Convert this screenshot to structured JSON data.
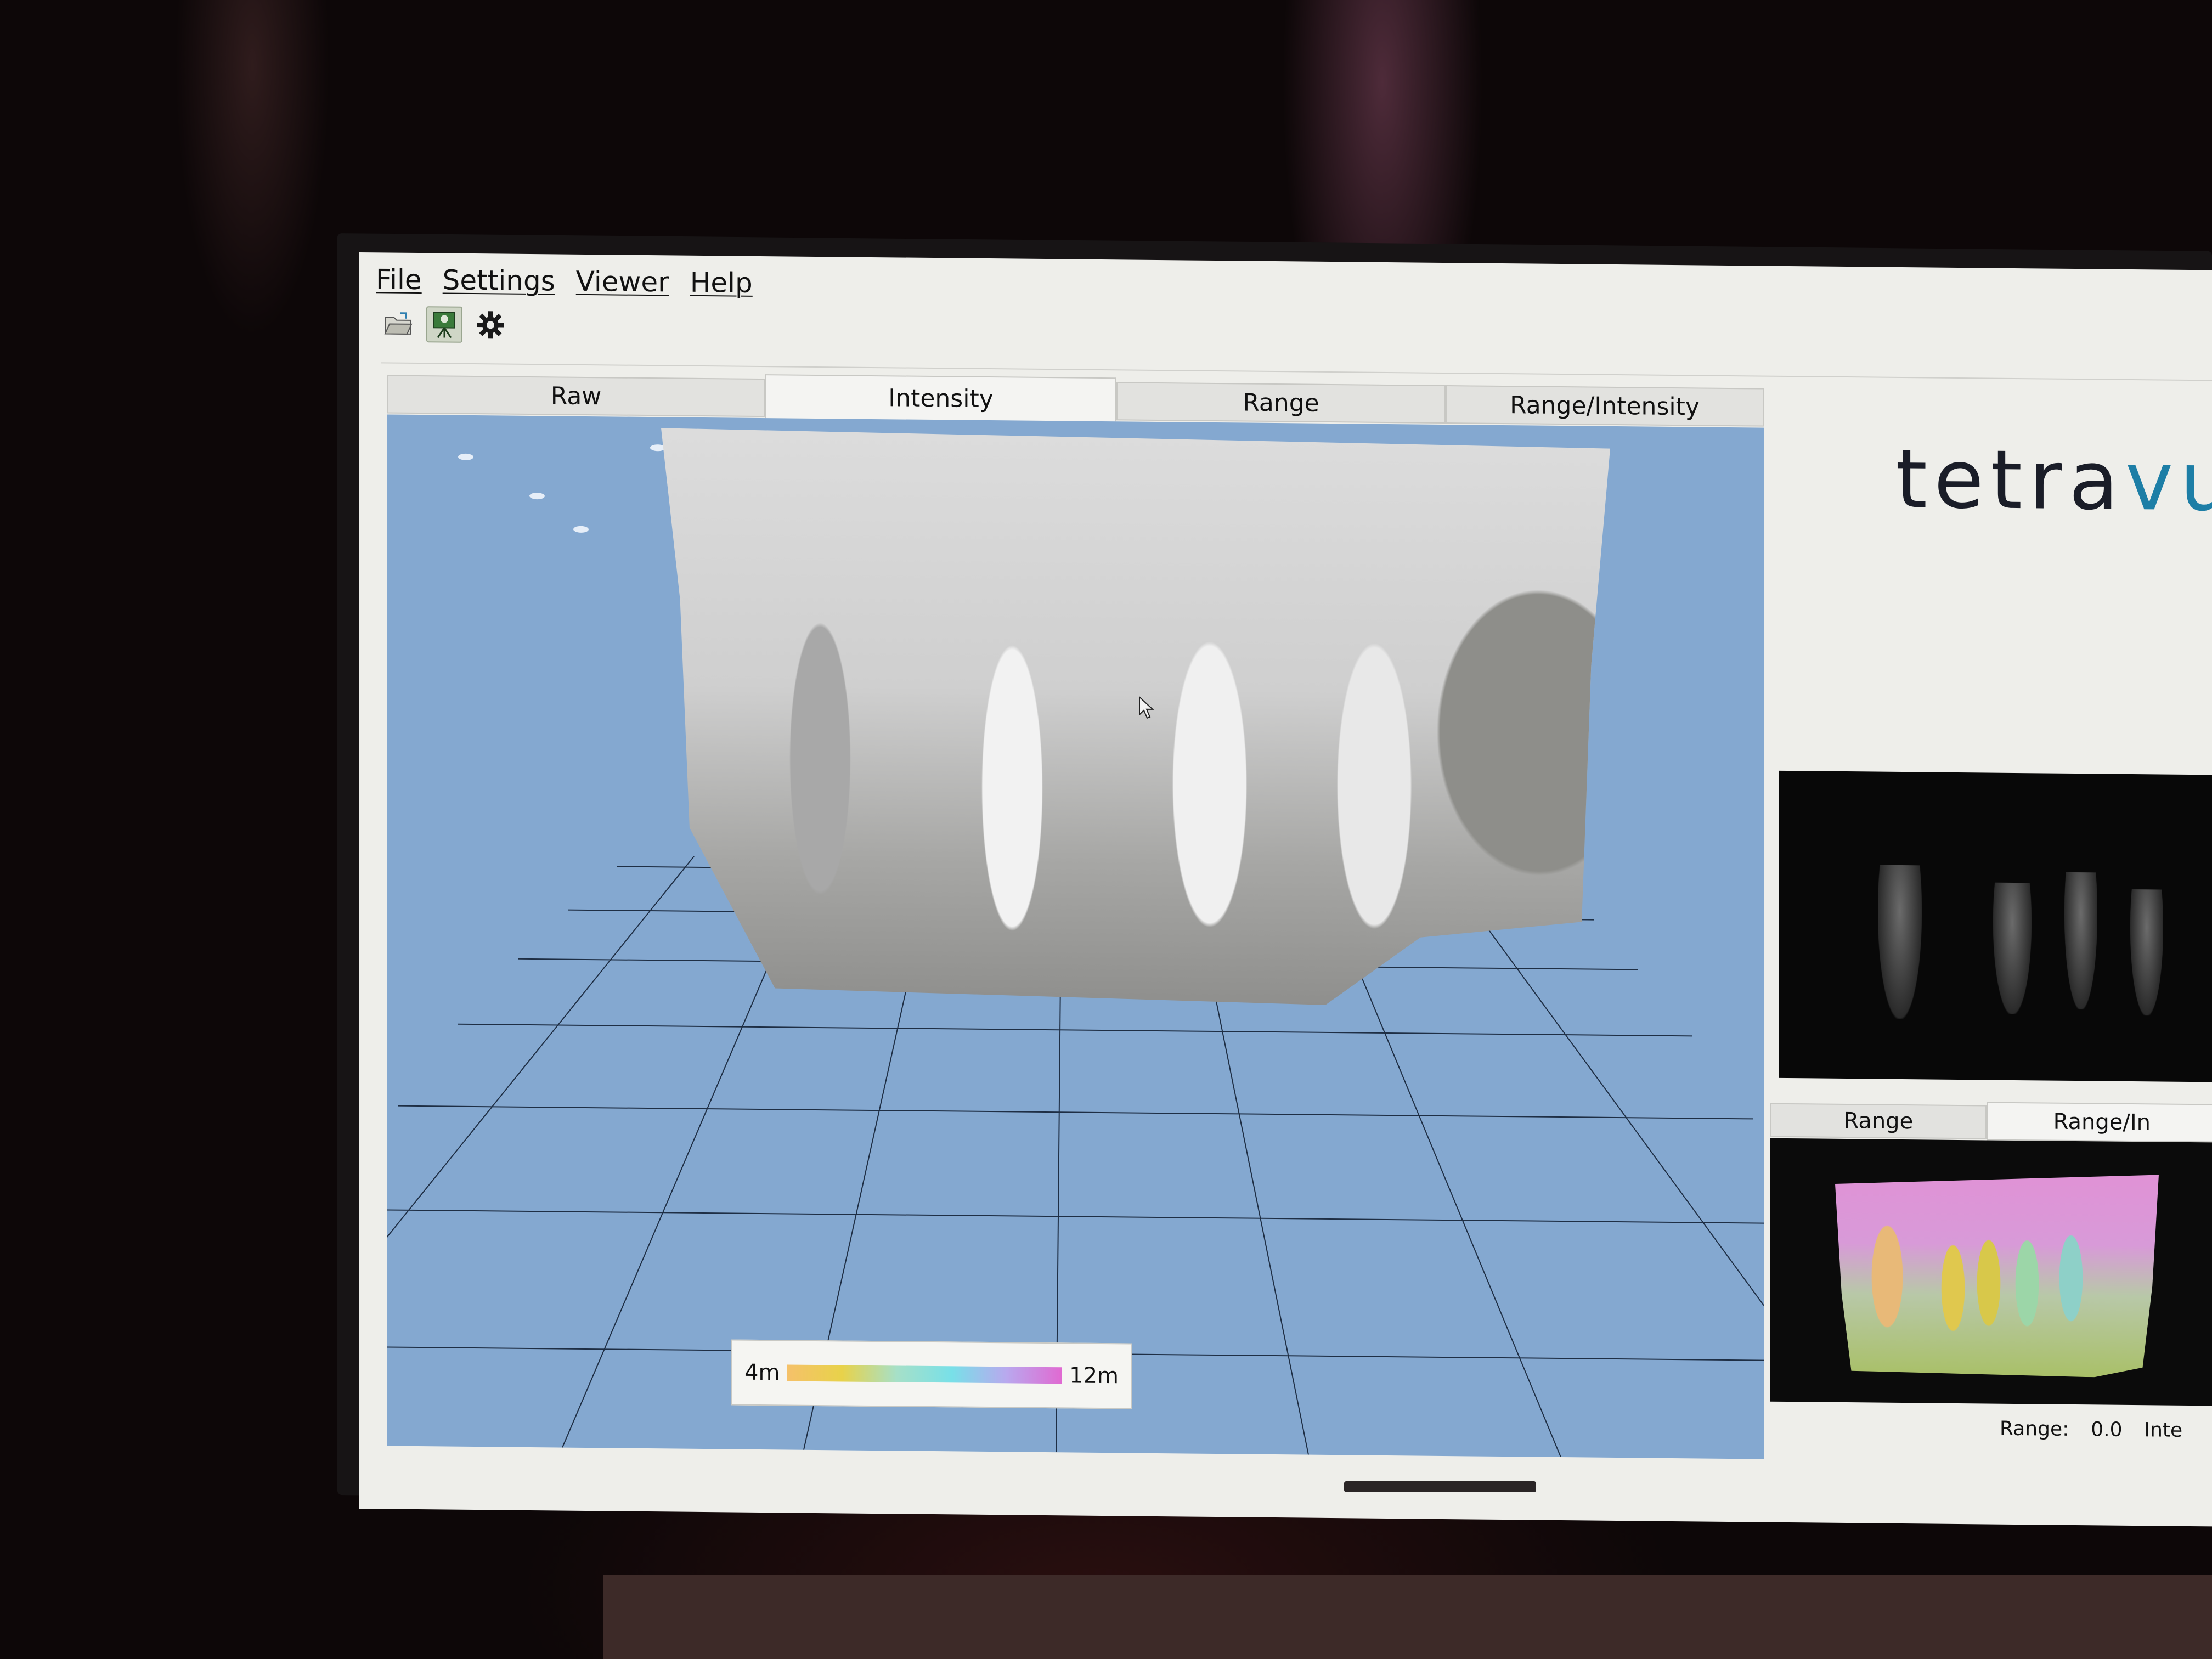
{
  "menu": {
    "file": "File",
    "settings": "Settings",
    "viewer": "Viewer",
    "help": "Help"
  },
  "toolbar": {
    "icons": [
      "folder-open-icon",
      "camera-tripod-icon",
      "gear-icon"
    ]
  },
  "main_tabs": [
    "Raw",
    "Intensity",
    "Range",
    "Range/Intensity"
  ],
  "active_main_tab": "Intensity",
  "colorbar": {
    "min_label": "4m",
    "max_label": "12m",
    "gradient_colors": [
      "#f5c16a",
      "#e8d24a",
      "#78e0e8",
      "#e06ad2"
    ]
  },
  "logo": {
    "text_main": "tetra",
    "text_accent": "vu"
  },
  "preview_tabs": [
    "Range",
    "Range/In"
  ],
  "active_preview_tab": "Range/In",
  "status": {
    "range_label": "Range:",
    "range_value": "0.0",
    "intensity_label_partial": "Inte"
  },
  "colors": {
    "viewport_bg": "#84a8d0",
    "logo_dark": "#1a1d28",
    "logo_accent": "#1d7ea6",
    "screen_bg": "#eeeeea"
  }
}
